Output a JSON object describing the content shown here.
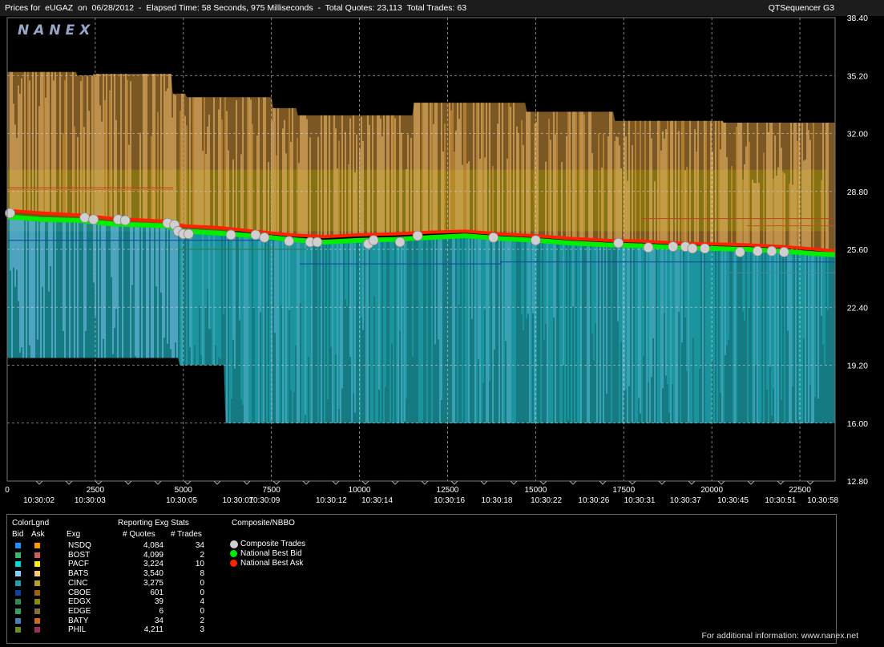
{
  "header": {
    "title": "Prices for  eUGAZ  on  06/28/2012  -  Elapsed Time: 58 Seconds, 975 Milliseconds  -  Total Quotes: 23,113  Total Trades: 63",
    "brand": "QTSequencer G3"
  },
  "logo": "NANEX",
  "chart_data": {
    "type": "line",
    "symbol": "eUGAZ",
    "date": "06/28/2012",
    "ylim": [
      12.8,
      38.4
    ],
    "y_ticks": [
      "38.40",
      "35.20",
      "32.00",
      "28.80",
      "25.60",
      "22.40",
      "19.20",
      "16.00",
      "12.80"
    ],
    "xlim": [
      0,
      23500
    ],
    "x_ticks": [
      "0",
      "2500",
      "5000",
      "7500",
      "10000",
      "12500",
      "15000",
      "17500",
      "20000",
      "22500"
    ],
    "x_time_labels": [
      {
        "x": 900,
        "label": "10:30:02"
      },
      {
        "x": 2350,
        "label": "10:30:03"
      },
      {
        "x": 4950,
        "label": "10:30:05"
      },
      {
        "x": 6550,
        "label": "10:30:07"
      },
      {
        "x": 7300,
        "label": "10:30:09"
      },
      {
        "x": 9200,
        "label": "10:30:12"
      },
      {
        "x": 10500,
        "label": "10:30:14"
      },
      {
        "x": 12550,
        "label": "10:30:16"
      },
      {
        "x": 13900,
        "label": "10:30:18"
      },
      {
        "x": 15300,
        "label": "10:30:22"
      },
      {
        "x": 16650,
        "label": "10:30:26"
      },
      {
        "x": 17950,
        "label": "10:30:31"
      },
      {
        "x": 19250,
        "label": "10:30:37"
      },
      {
        "x": 20600,
        "label": "10:30:45"
      },
      {
        "x": 21950,
        "label": "10:30:51"
      },
      {
        "x": 23150,
        "label": "10:30:58"
      }
    ],
    "grid": true,
    "series": [
      {
        "name": "National Best Bid",
        "color": "#00ee00",
        "x": [
          0,
          1000,
          2000,
          3000,
          4500,
          5000,
          6000,
          7000,
          8000,
          9000,
          10000,
          11000,
          12000,
          13000,
          14000,
          15000,
          16000,
          17000,
          18000,
          19000,
          20000,
          21000,
          22000,
          23000,
          23500
        ],
        "values": [
          27.4,
          27.25,
          27.2,
          27.0,
          26.9,
          26.6,
          26.5,
          26.35,
          26.15,
          26.0,
          26.1,
          26.15,
          26.25,
          26.35,
          26.2,
          26.1,
          25.95,
          25.85,
          25.8,
          25.7,
          25.65,
          25.6,
          25.5,
          25.35,
          25.3
        ]
      },
      {
        "name": "National Best Ask",
        "color": "#ff2200",
        "x": [
          0,
          1000,
          2000,
          3000,
          4500,
          5000,
          6000,
          7000,
          8000,
          9000,
          10000,
          11000,
          12000,
          13000,
          14000,
          15000,
          16000,
          17000,
          18000,
          19000,
          20000,
          21000,
          22000,
          23000,
          23500
        ],
        "values": [
          27.75,
          27.6,
          27.5,
          27.3,
          27.15,
          26.9,
          26.8,
          26.6,
          26.4,
          26.3,
          26.4,
          26.45,
          26.55,
          26.6,
          26.45,
          26.35,
          26.2,
          26.1,
          26.05,
          25.95,
          25.9,
          25.85,
          25.75,
          25.6,
          25.5
        ]
      }
    ],
    "trades": {
      "name": "Composite Trades",
      "color": "#cfcfcf",
      "x": [
        80,
        2200,
        2450,
        3150,
        3350,
        4550,
        4750,
        4850,
        5000,
        5150,
        6350,
        7050,
        7300,
        8000,
        8600,
        8800,
        10250,
        10400,
        11150,
        11650,
        13800,
        15000,
        17350,
        18200,
        18900,
        19250,
        19450,
        19800,
        20800,
        21300,
        21700,
        22050
      ],
      "values": [
        27.6,
        27.35,
        27.25,
        27.25,
        27.2,
        27.05,
        26.95,
        26.6,
        26.45,
        26.45,
        26.4,
        26.4,
        26.25,
        26.05,
        26.0,
        26.0,
        25.9,
        26.1,
        26.0,
        26.35,
        26.25,
        26.1,
        25.95,
        25.7,
        25.75,
        25.75,
        25.65,
        25.65,
        25.45,
        25.5,
        25.5,
        25.45
      ]
    },
    "exchange_bands": {
      "bats_ask_top": [
        {
          "x": [
            0,
            1950
          ],
          "value": 35.4
        },
        {
          "x": [
            1950,
            2450
          ],
          "value": 35.2
        },
        {
          "x": [
            2450,
            4650
          ],
          "value": 35.3
        },
        {
          "x": [
            4650,
            5050
          ],
          "value": 34.2
        },
        {
          "x": [
            5050,
            7500
          ],
          "value": 34.0
        },
        {
          "x": [
            7500,
            8200
          ],
          "value": 33.4
        },
        {
          "x": [
            8200,
            11500
          ],
          "value": 33.0
        },
        {
          "x": [
            11500,
            14700
          ],
          "value": 33.7
        },
        {
          "x": [
            14700,
            17200
          ],
          "value": 33.2
        },
        {
          "x": [
            17200,
            20300
          ],
          "value": 32.7
        },
        {
          "x": [
            20300,
            23500
          ],
          "value": 32.6
        }
      ],
      "amex_ask_band": [
        30.0,
        26.6
      ],
      "bats_bid_bottom": [
        {
          "x": [
            0,
            4850
          ],
          "value": 19.6
        },
        {
          "x": [
            4850,
            6150
          ],
          "value": 19.2
        }
      ],
      "cinc_bid_bottom": [
        {
          "x": [
            6150,
            23500
          ],
          "value": 16.0
        }
      ],
      "floor_level": [
        {
          "x": [
            0,
            4850
          ],
          "value": 19.2
        },
        {
          "x": [
            4850,
            6150
          ],
          "value": 16.0
        }
      ]
    }
  },
  "legend": {
    "color_legend_title": "ColorLgnd",
    "bid_header": "Bid",
    "ask_header": "Ask",
    "exchange_header": "Exg",
    "stats_title": "Reporting Exg Stats",
    "quotes_header": "# Quotes",
    "trades_header": "# Trades",
    "composite_title": "Composite/NBBO",
    "rows": [
      {
        "exg": "NSDQ",
        "quotes": "4,084",
        "trades": "34",
        "bid_color": "#1e90ff",
        "ask_color": "#ff9900"
      },
      {
        "exg": "BOST",
        "quotes": "4,099",
        "trades": "2",
        "bid_color": "#3cb371",
        "ask_color": "#cd5c5c"
      },
      {
        "exg": "PACF",
        "quotes": "3,224",
        "trades": "10",
        "bid_color": "#00d8d8",
        "ask_color": "#ffee00"
      },
      {
        "exg": "BATS",
        "quotes": "3,540",
        "trades": "8",
        "bid_color": "#87cefa",
        "ask_color": "#ffc878"
      },
      {
        "exg": "CINC",
        "quotes": "3,275",
        "trades": "0",
        "bid_color": "#20a0a8",
        "ask_color": "#b8a020"
      },
      {
        "exg": "CBOE",
        "quotes": "601",
        "trades": "0",
        "bid_color": "#1040a0",
        "ask_color": "#a06010"
      },
      {
        "exg": "EDGX",
        "quotes": "39",
        "trades": "4",
        "bid_color": "#2e8b57",
        "ask_color": "#8b8b00"
      },
      {
        "exg": "EDGE",
        "quotes": "6",
        "trades": "0",
        "bid_color": "#3aa060",
        "ask_color": "#8a6d3b"
      },
      {
        "exg": "BATY",
        "quotes": "34",
        "trades": "2",
        "bid_color": "#4682b4",
        "ask_color": "#d2691e"
      },
      {
        "exg": "PHIL",
        "quotes": "4,211",
        "trades": "3",
        "bid_color": "#6b8e23",
        "ask_color": "#9b3060"
      }
    ],
    "composite_items": [
      {
        "label": "Composite Trades",
        "color": "#cfcfcf"
      },
      {
        "label": "National Best Bid",
        "color": "#00ee00"
      },
      {
        "label": "National Best Ask",
        "color": "#ff2200"
      }
    ]
  },
  "footer": "For additional information: www.nanex.net"
}
